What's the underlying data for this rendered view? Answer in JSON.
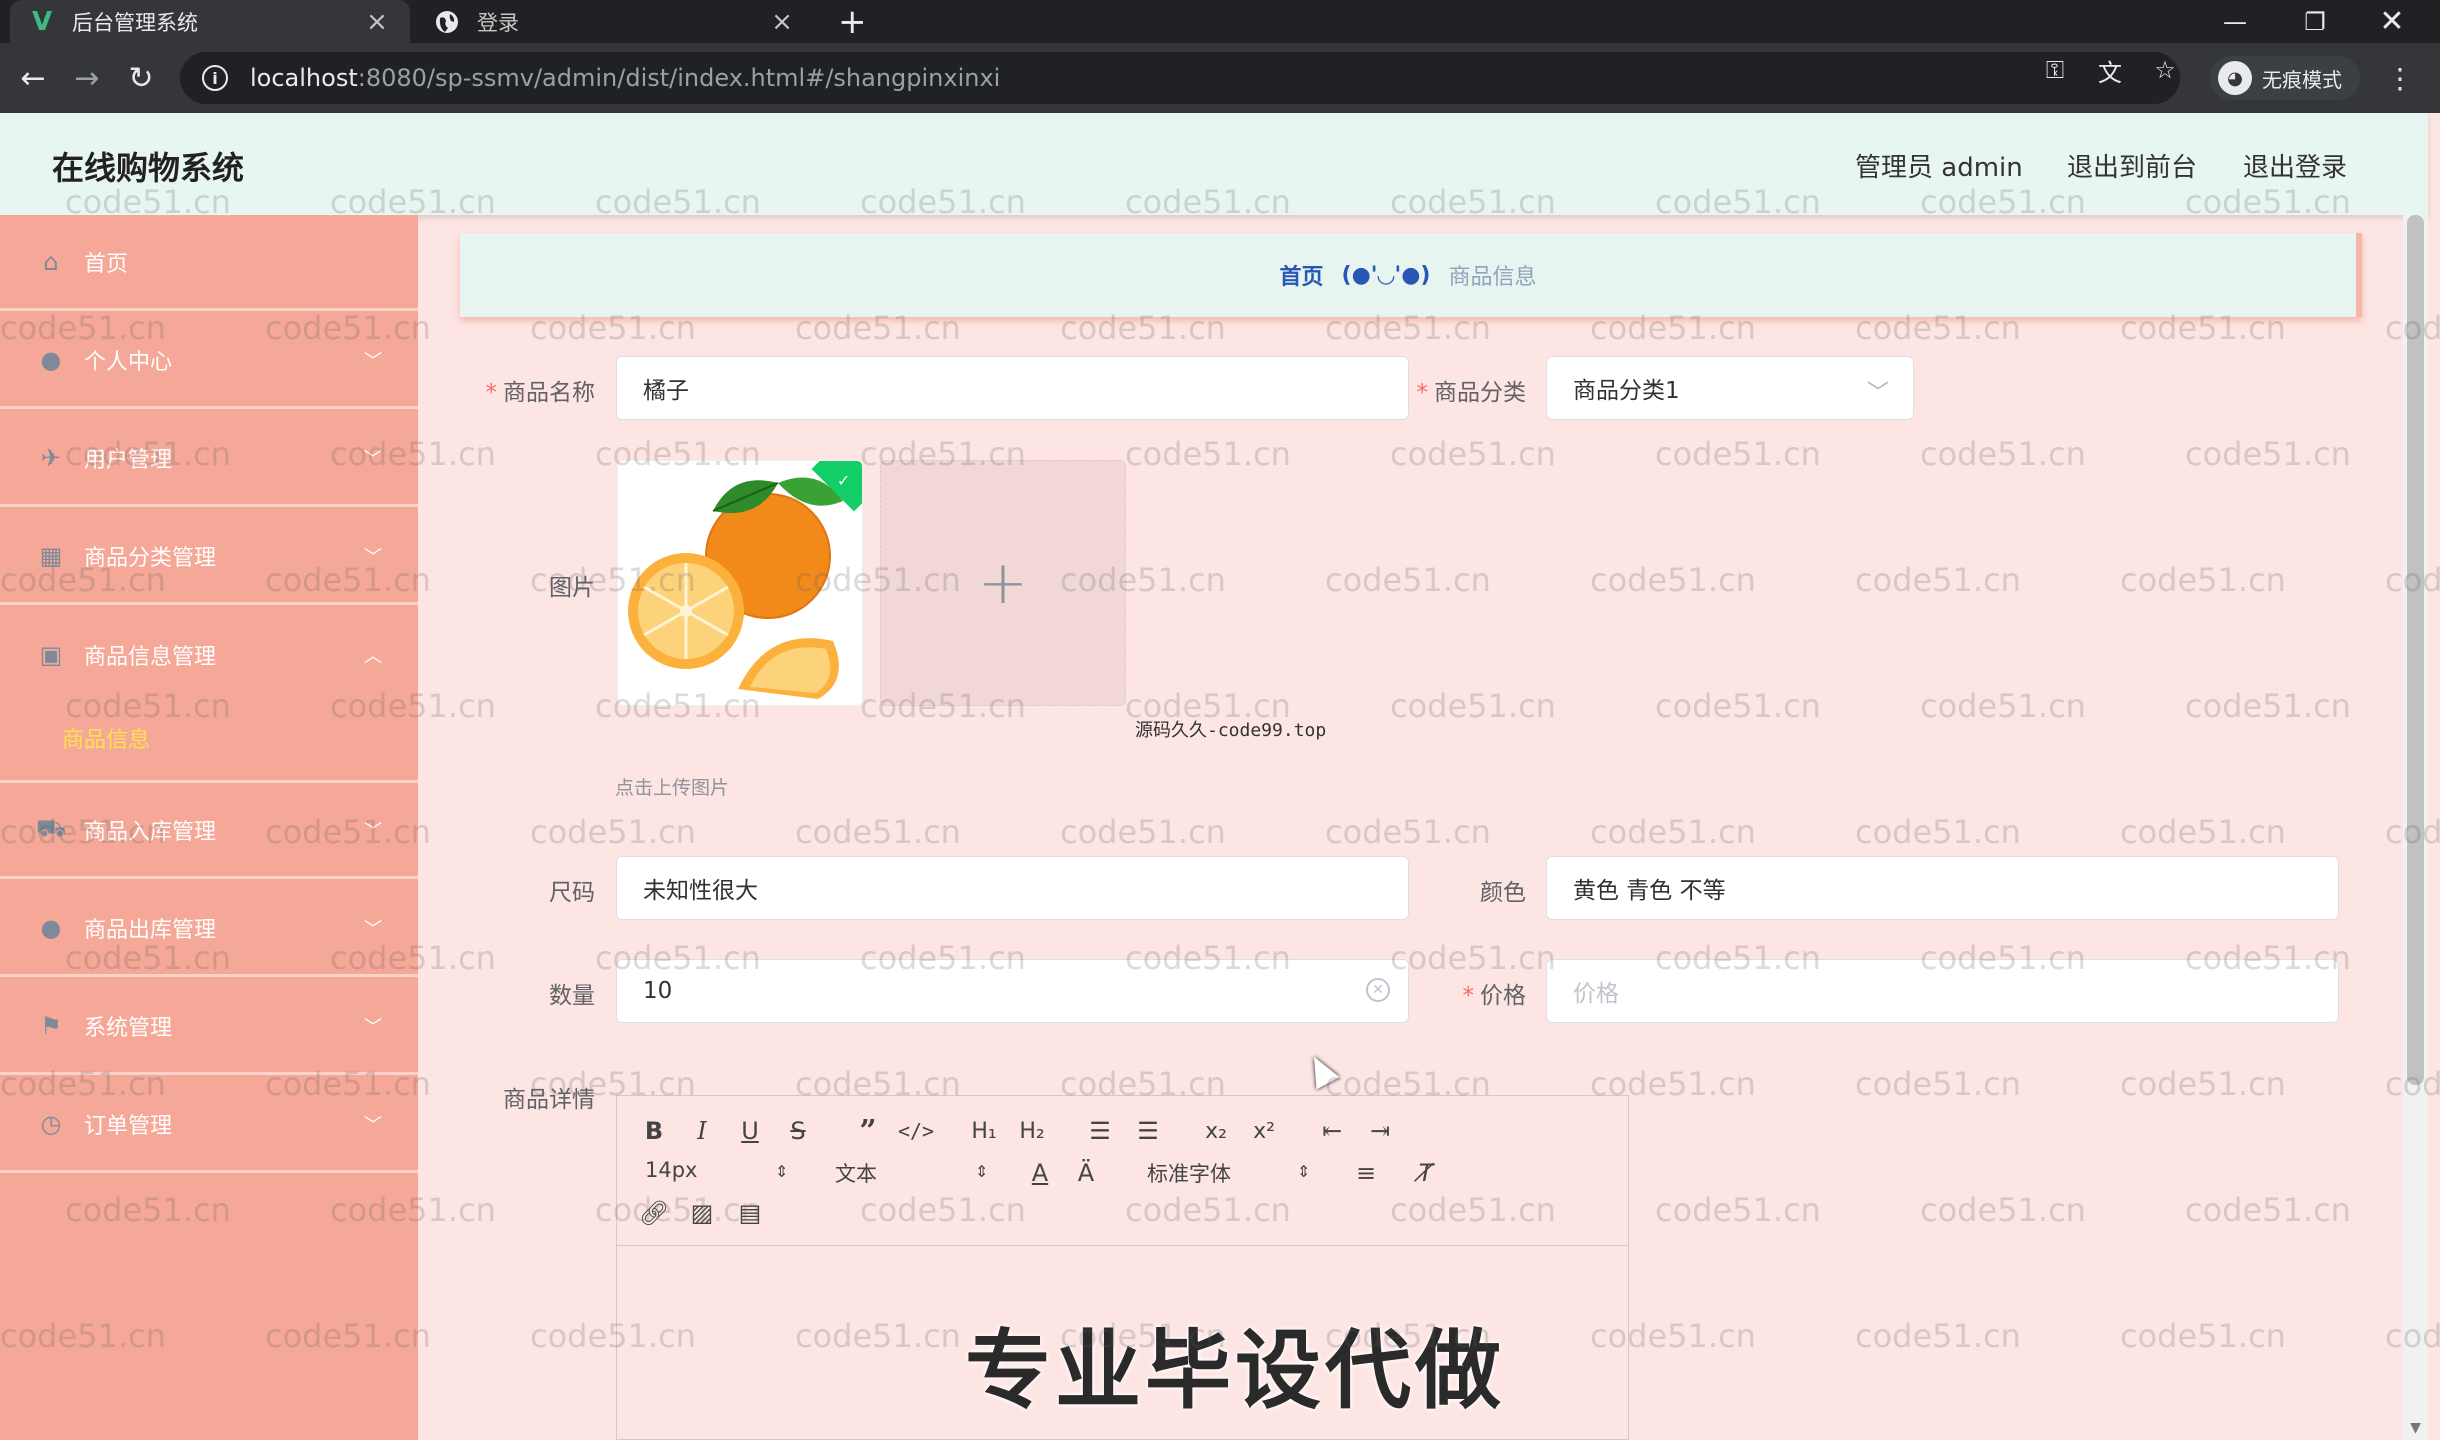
{
  "browser": {
    "tabs": [
      {
        "title": "后台管理系统",
        "favicon": "V",
        "active": true
      },
      {
        "title": "登录",
        "favicon": "globe-icon",
        "active": false
      }
    ],
    "url_host": "localhost",
    "url_path": ":8080/sp-ssmv/admin/dist/index.html#/shangpinxinxi",
    "incognito_label": "无痕模式"
  },
  "header": {
    "title": "在线购物系统",
    "admin_label": "管理员 admin",
    "front_link": "退出到前台",
    "logout_link": "退出登录"
  },
  "sidebar": {
    "items": [
      {
        "label": "首页",
        "icon": "home-icon"
      },
      {
        "label": "个人中心",
        "icon": "user-icon"
      },
      {
        "label": "用户管理",
        "icon": "pin-icon"
      },
      {
        "label": "商品分类管理",
        "icon": "grid-icon"
      },
      {
        "label": "商品信息管理",
        "icon": "clipboard-icon",
        "expanded": true
      },
      {
        "label": "商品入库管理",
        "icon": "truck-icon"
      },
      {
        "label": "商品出库管理",
        "icon": "user-icon"
      },
      {
        "label": "系统管理",
        "icon": "flag-icon"
      },
      {
        "label": "订单管理",
        "icon": "clock-icon"
      }
    ],
    "active_sub": "商品信息"
  },
  "breadcrumb": {
    "home": "首页",
    "separator": "(●'◡'●)",
    "current": "商品信息"
  },
  "form": {
    "name_label": "商品名称",
    "name_value": "橘子",
    "category_label": "商品分类",
    "category_value": "商品分类1",
    "image_label": "图片",
    "upload_tip": "点击上传图片",
    "image_watermark": "源码久久-code99.top",
    "size_label": "尺码",
    "size_value": "未知性很大",
    "color_label": "颜色",
    "color_value": "黄色 青色 不等",
    "quantity_label": "数量",
    "quantity_value": "10",
    "price_label": "价格",
    "price_placeholder": "价格",
    "detail_label": "商品详情"
  },
  "editor": {
    "font_size": "14px",
    "text_type": "文本",
    "font_family": "标准字体"
  },
  "overlay_ad": "专业毕设代做",
  "watermark": "code51.cn"
}
